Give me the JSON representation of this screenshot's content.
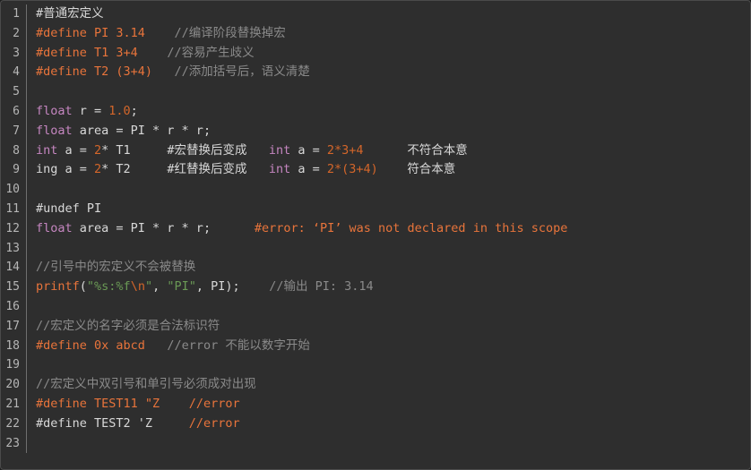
{
  "editor": {
    "name": "c-macro-demo-code-view",
    "background": "#2e2e2e",
    "gutter_color": "#b6b6b6",
    "border_color": "#4a4a4a",
    "colors": {
      "plain": "#d8d8d8",
      "preprocessor": "#e8743b",
      "comment": "#8a8a8a",
      "keyword": "#c586c0",
      "number": "#d4662a",
      "string": "#6a9955",
      "error": "#e8743b"
    }
  },
  "lines": [
    {
      "num": "1",
      "tokens": [
        {
          "t": "#普通宏定义",
          "c": "plain"
        }
      ]
    },
    {
      "num": "2",
      "tokens": [
        {
          "t": "#define PI 3.14",
          "c": "pre"
        },
        {
          "t": "    ",
          "c": "plain"
        },
        {
          "t": "//编译阶段替换掉宏",
          "c": "comment"
        }
      ]
    },
    {
      "num": "3",
      "tokens": [
        {
          "t": "#define T1 3+4",
          "c": "pre"
        },
        {
          "t": "    ",
          "c": "plain"
        },
        {
          "t": "//容易产生歧义",
          "c": "comment"
        }
      ]
    },
    {
      "num": "4",
      "tokens": [
        {
          "t": "#define T2 (3+4)",
          "c": "pre"
        },
        {
          "t": "   ",
          "c": "plain"
        },
        {
          "t": "//添加括号后，语义清楚",
          "c": "comment"
        }
      ]
    },
    {
      "num": "5",
      "tokens": []
    },
    {
      "num": "6",
      "tokens": [
        {
          "t": "float",
          "c": "keyword"
        },
        {
          "t": " r = ",
          "c": "plain"
        },
        {
          "t": "1.0",
          "c": "number"
        },
        {
          "t": ";",
          "c": "plain"
        }
      ]
    },
    {
      "num": "7",
      "tokens": [
        {
          "t": "float",
          "c": "keyword"
        },
        {
          "t": " area = PI * r * r;",
          "c": "plain"
        }
      ]
    },
    {
      "num": "8",
      "tokens": [
        {
          "t": "int",
          "c": "keyword"
        },
        {
          "t": " a = ",
          "c": "plain"
        },
        {
          "t": "2",
          "c": "number"
        },
        {
          "t": "* T1",
          "c": "plain"
        },
        {
          "t": "     ",
          "c": "plain"
        },
        {
          "t": "#宏替换后变成",
          "c": "cn"
        },
        {
          "t": "   ",
          "c": "plain"
        },
        {
          "t": "int",
          "c": "keyword"
        },
        {
          "t": " a = ",
          "c": "plain"
        },
        {
          "t": "2*3+4",
          "c": "number"
        },
        {
          "t": "      ",
          "c": "plain"
        },
        {
          "t": "不符合本意",
          "c": "cn"
        }
      ]
    },
    {
      "num": "9",
      "tokens": [
        {
          "t": "ing a = ",
          "c": "plain"
        },
        {
          "t": "2",
          "c": "number"
        },
        {
          "t": "* T2",
          "c": "plain"
        },
        {
          "t": "     ",
          "c": "plain"
        },
        {
          "t": "#红替换后变成",
          "c": "cn"
        },
        {
          "t": "   ",
          "c": "plain"
        },
        {
          "t": "int",
          "c": "keyword"
        },
        {
          "t": " a = ",
          "c": "plain"
        },
        {
          "t": "2*(3+4)",
          "c": "number"
        },
        {
          "t": "    ",
          "c": "plain"
        },
        {
          "t": "符合本意",
          "c": "cn"
        }
      ]
    },
    {
      "num": "10",
      "tokens": []
    },
    {
      "num": "11",
      "tokens": [
        {
          "t": "#undef PI",
          "c": "plain"
        }
      ]
    },
    {
      "num": "12",
      "tokens": [
        {
          "t": "float",
          "c": "keyword"
        },
        {
          "t": " area = PI * r * r;",
          "c": "plain"
        },
        {
          "t": "      ",
          "c": "plain"
        },
        {
          "t": "#error: ‘PI’ was not declared in this scope",
          "c": "error"
        }
      ]
    },
    {
      "num": "13",
      "tokens": []
    },
    {
      "num": "14",
      "tokens": [
        {
          "t": "//引号中的宏定义不会被替换",
          "c": "comment"
        }
      ]
    },
    {
      "num": "15",
      "tokens": [
        {
          "t": "printf",
          "c": "func"
        },
        {
          "t": "(",
          "c": "plain"
        },
        {
          "t": "\"%s:%f",
          "c": "string"
        },
        {
          "t": "\\n",
          "c": "escape"
        },
        {
          "t": "\"",
          "c": "string"
        },
        {
          "t": ", ",
          "c": "plain"
        },
        {
          "t": "\"PI\"",
          "c": "string"
        },
        {
          "t": ", PI);",
          "c": "plain"
        },
        {
          "t": "    ",
          "c": "plain"
        },
        {
          "t": "//输出 PI: 3.14",
          "c": "comment"
        }
      ]
    },
    {
      "num": "16",
      "tokens": []
    },
    {
      "num": "17",
      "tokens": [
        {
          "t": "//宏定义的名字必须是合法标识符",
          "c": "comment"
        }
      ]
    },
    {
      "num": "18",
      "tokens": [
        {
          "t": "#define 0x abcd",
          "c": "pre"
        },
        {
          "t": "   ",
          "c": "plain"
        },
        {
          "t": "//error 不能以数字开始",
          "c": "comment"
        }
      ]
    },
    {
      "num": "19",
      "tokens": []
    },
    {
      "num": "20",
      "tokens": [
        {
          "t": "//宏定义中双引号和单引号必须成对出现",
          "c": "comment"
        }
      ]
    },
    {
      "num": "21",
      "tokens": [
        {
          "t": "#define TEST11 \"Z",
          "c": "pre"
        },
        {
          "t": "    ",
          "c": "plain"
        },
        {
          "t": "//error",
          "c": "pre"
        }
      ]
    },
    {
      "num": "22",
      "tokens": [
        {
          "t": "#define TEST2 'Z",
          "c": "plain"
        },
        {
          "t": "     ",
          "c": "plain"
        },
        {
          "t": "//error",
          "c": "pre"
        }
      ]
    },
    {
      "num": "23",
      "tokens": []
    }
  ]
}
